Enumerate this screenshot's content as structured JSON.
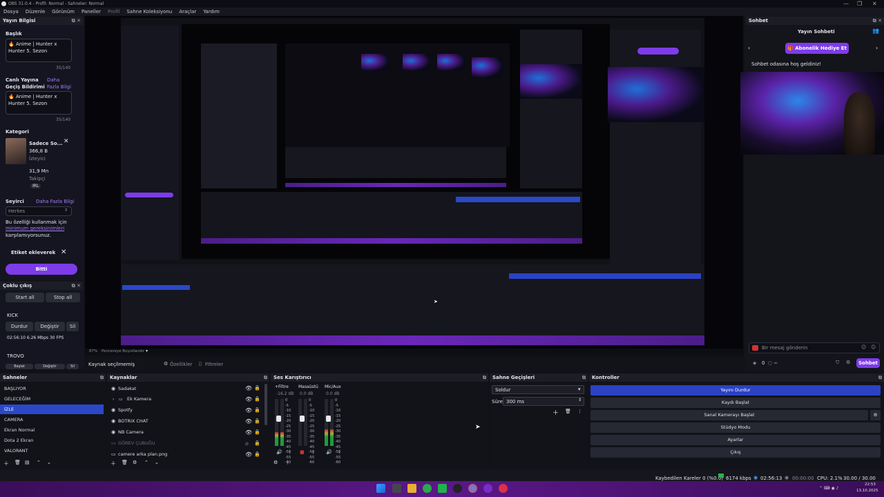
{
  "window": {
    "title": "OBS 31.0.4 - Profil: Normal - Sahneler: Normal",
    "controls": [
      "—",
      "❐",
      "✕"
    ]
  },
  "menu": {
    "items": [
      "Dosya",
      "Düzenle",
      "Görünüm",
      "Paneller",
      "Profil",
      "Sahne Koleksiyonu",
      "Araçlar",
      "Yardım"
    ]
  },
  "stream_info": {
    "dock_title": "Yayın Bilgisi",
    "title_label": "Başlık",
    "title_line1": "🔥 Anime | Hunter x",
    "title_line2": "Hunter 5. Sezon",
    "title_count": "35/140",
    "notif_label_1": "Canlı Yayına",
    "notif_label_2": "Geçiş Bildirimi",
    "more_link_1": "Daha",
    "more_link_2": "Fazla Bilgi",
    "notif_line1": "🔥 Anime | Hunter x",
    "notif_line2": "Hunter 5. Sezon",
    "notif_count": "35/140",
    "category_label": "Kategori",
    "category_name": "Sadece So...",
    "viewers_value": "366,8 B",
    "viewers_label": "İzleyici",
    "followers_value": "31,9 Mn",
    "followers_label": "Takipçi",
    "category_tag": "IRL",
    "audience_label": "Seyirci",
    "audience_more": "Daha Fazla Bilgi",
    "audience_value": "Herkes",
    "notice_1": "Bu özelliği kullanmak için",
    "notice_link": "minimum gereksinimleri",
    "notice_2": "karşılamıyorsunuz.",
    "tags_label": "Etiket ekleverek",
    "done_button": "Bitti"
  },
  "multistream": {
    "dock_title": "Çoklu çıkış",
    "start_all": "Start all",
    "stop_all": "Stop all",
    "kick_label": "KICK",
    "stop_btn": "Durdur",
    "change_btn": "Değiştir",
    "delete_btn": "Sil",
    "stats": "02:56:10  6.26 Mbps  30 FPS",
    "trovo_label": "TROVO",
    "trovo_btn1": "Başlat",
    "trovo_btn2": "Değiştir",
    "trovo_btn3": "Sil"
  },
  "preview_toolbar": {
    "zoom": "87%",
    "fit_label": "Pencereye Boyutlandır",
    "no_source": "Kaynak seçilmemiş",
    "properties": "Özellikler",
    "filters": "Filtreler"
  },
  "chat": {
    "dock_title": "Sohbet",
    "header": "Yayın Sohbeti",
    "gift_button": "Abonelik Hediye Et",
    "welcome": "Sohbet odasına hoş geldiniz!",
    "message_placeholder": "Bir mesaj gönderin",
    "viewer_count": "0",
    "send_button": "Sohbet"
  },
  "scenes": {
    "title": "Sahneler",
    "items": [
      "BAŞLIYOR",
      "GELECEĞİM",
      "İZLE",
      "CAMERA",
      "Ekran Normal",
      "Dota 2 Ekran",
      "VALORANT"
    ],
    "selected_index": 2
  },
  "sources": {
    "title": "Kaynaklar",
    "items": [
      {
        "name": "Sadakat",
        "dim": false
      },
      {
        "name": "Ek Kamera",
        "dim": false
      },
      {
        "name": "Spotfy",
        "dim": false
      },
      {
        "name": "BOTRIX CHAT",
        "dim": false
      },
      {
        "name": "NB Camera",
        "dim": false
      },
      {
        "name": "GÖREV ÇUBUĞU",
        "dim": true
      },
      {
        "name": "camere arka plan.png",
        "dim": false
      }
    ]
  },
  "mixer": {
    "title": "Ses Karıştırıcı",
    "channels": [
      {
        "name": "+Filtre",
        "db": "-16.2 dB",
        "level": 0.3
      },
      {
        "name": "Masaüstü",
        "db": "0.0 dB",
        "level": 0.0
      },
      {
        "name": "Mic/Aux",
        "db": "0.0 dB",
        "level": 0.35
      }
    ],
    "scale": [
      "0",
      "-5",
      "-10",
      "-15",
      "-20",
      "-25",
      "-30",
      "-35",
      "-40",
      "-45",
      "-50",
      "-55",
      "-60"
    ]
  },
  "transitions": {
    "title": "Sahne Geçişleri",
    "selected": "Soldur",
    "duration_label": "Süre",
    "duration_value": "300 ms"
  },
  "controls": {
    "title": "Kontroller",
    "buttons": [
      "Yayını Durdur",
      "Kaydı Başlat",
      "Sanal Kamerayı Başlat",
      "Stüdyo Modu",
      "Ayarlar",
      "Çıkış"
    ]
  },
  "status": {
    "dropped": "Kaybedilen Kareler 0 (%0.0)",
    "bitrate": "6174 kbps",
    "stream_time": "02:56:13",
    "rec_time": "00:00:00",
    "cpu": "CPU: 2.1%",
    "fps": "30.00 / 30.00 FPS"
  },
  "taskbar": {
    "time": "22:53",
    "date": "13.10.2025"
  },
  "colors": {
    "accent_purple": "#7d3ce8",
    "selection_blue": "#2a48c8",
    "link_purple": "#a57cf5"
  }
}
